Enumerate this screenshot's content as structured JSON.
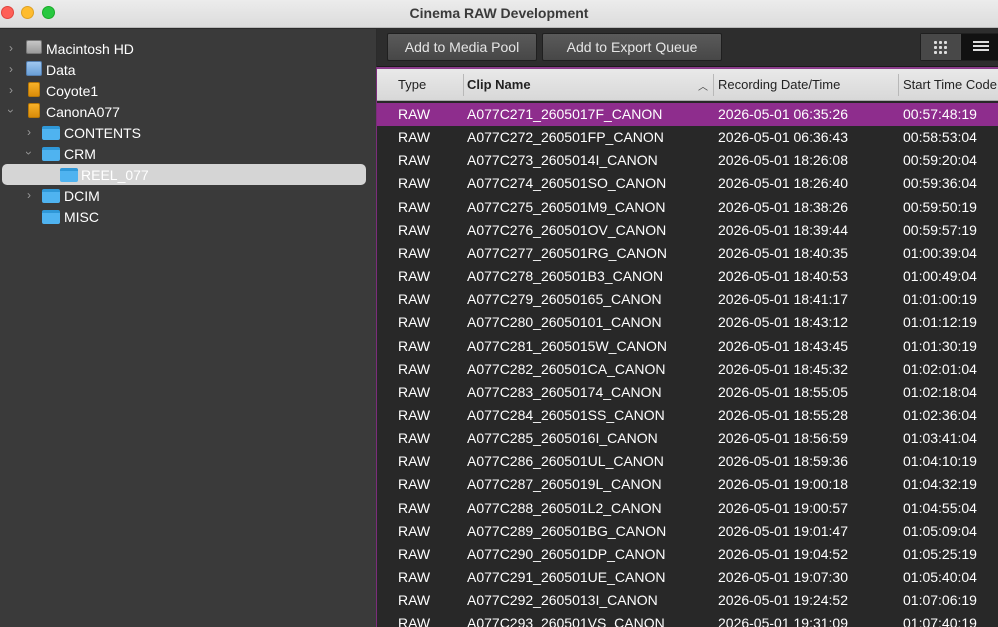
{
  "window": {
    "title": "Cinema RAW Development"
  },
  "sidebar": {
    "items": [
      {
        "label": "Macintosh HD",
        "icon": "internal-drive-icon",
        "expanded": false
      },
      {
        "label": "Data",
        "icon": "drive-icon",
        "expanded": false
      },
      {
        "label": "Coyote1",
        "icon": "external-drive-icon",
        "expanded": false
      },
      {
        "label": "CanonA077",
        "icon": "external-drive-icon",
        "expanded": true
      },
      {
        "label": "CONTENTS",
        "icon": "folder-icon",
        "expanded": false
      },
      {
        "label": "CRM",
        "icon": "folder-icon",
        "expanded": true
      },
      {
        "label": "REEL_077",
        "icon": "folder-icon",
        "selected": true
      },
      {
        "label": "DCIM",
        "icon": "folder-icon",
        "expanded": false
      },
      {
        "label": "MISC",
        "icon": "folder-icon"
      }
    ]
  },
  "toolbar": {
    "add_media_pool": "Add to Media Pool",
    "add_export_queue": "Add to Export Queue",
    "active_view": "list"
  },
  "table": {
    "columns": {
      "type": "Type",
      "clip_name": "Clip Name",
      "date": "Recording Date/Time",
      "timecode": "Start Time Code"
    },
    "rows": [
      {
        "type": "RAW",
        "name": "A077C271_2605017F_CANON",
        "date": "2026-05-01 06:35:26",
        "tc": "00:57:48:19"
      },
      {
        "type": "RAW",
        "name": "A077C272_260501FP_CANON",
        "date": "2026-05-01 06:36:43",
        "tc": "00:58:53:04"
      },
      {
        "type": "RAW",
        "name": "A077C273_2605014I_CANON",
        "date": "2026-05-01 18:26:08",
        "tc": "00:59:20:04"
      },
      {
        "type": "RAW",
        "name": "A077C274_260501SO_CANON",
        "date": "2026-05-01 18:26:40",
        "tc": "00:59:36:04"
      },
      {
        "type": "RAW",
        "name": "A077C275_260501M9_CANON",
        "date": "2026-05-01 18:38:26",
        "tc": "00:59:50:19"
      },
      {
        "type": "RAW",
        "name": "A077C276_260501OV_CANON",
        "date": "2026-05-01 18:39:44",
        "tc": "00:59:57:19"
      },
      {
        "type": "RAW",
        "name": "A077C277_260501RG_CANON",
        "date": "2026-05-01 18:40:35",
        "tc": "01:00:39:04"
      },
      {
        "type": "RAW",
        "name": "A077C278_260501B3_CANON",
        "date": "2026-05-01 18:40:53",
        "tc": "01:00:49:04"
      },
      {
        "type": "RAW",
        "name": "A077C279_26050165_CANON",
        "date": "2026-05-01 18:41:17",
        "tc": "01:01:00:19"
      },
      {
        "type": "RAW",
        "name": "A077C280_26050101_CANON",
        "date": "2026-05-01 18:43:12",
        "tc": "01:01:12:19"
      },
      {
        "type": "RAW",
        "name": "A077C281_2605015W_CANON",
        "date": "2026-05-01 18:43:45",
        "tc": "01:01:30:19"
      },
      {
        "type": "RAW",
        "name": "A077C282_260501CA_CANON",
        "date": "2026-05-01 18:45:32",
        "tc": "01:02:01:04"
      },
      {
        "type": "RAW",
        "name": "A077C283_26050174_CANON",
        "date": "2026-05-01 18:55:05",
        "tc": "01:02:18:04"
      },
      {
        "type": "RAW",
        "name": "A077C284_260501SS_CANON",
        "date": "2026-05-01 18:55:28",
        "tc": "01:02:36:04"
      },
      {
        "type": "RAW",
        "name": "A077C285_2605016I_CANON",
        "date": "2026-05-01 18:56:59",
        "tc": "01:03:41:04"
      },
      {
        "type": "RAW",
        "name": "A077C286_260501UL_CANON",
        "date": "2026-05-01 18:59:36",
        "tc": "01:04:10:19"
      },
      {
        "type": "RAW",
        "name": "A077C287_2605019L_CANON",
        "date": "2026-05-01 19:00:18",
        "tc": "01:04:32:19"
      },
      {
        "type": "RAW",
        "name": "A077C288_260501L2_CANON",
        "date": "2026-05-01 19:00:57",
        "tc": "01:04:55:04"
      },
      {
        "type": "RAW",
        "name": "A077C289_260501BG_CANON",
        "date": "2026-05-01 19:01:47",
        "tc": "01:05:09:04"
      },
      {
        "type": "RAW",
        "name": "A077C290_260501DP_CANON",
        "date": "2026-05-01 19:04:52",
        "tc": "01:05:25:19"
      },
      {
        "type": "RAW",
        "name": "A077C291_260501UE_CANON",
        "date": "2026-05-01 19:07:30",
        "tc": "01:05:40:04"
      },
      {
        "type": "RAW",
        "name": "A077C292_2605013I_CANON",
        "date": "2026-05-01 19:24:52",
        "tc": "01:07:06:19"
      },
      {
        "type": "RAW",
        "name": "A077C293_260501VS_CANON",
        "date": "2026-05-01 19:31:09",
        "tc": "01:07:40:19"
      }
    ],
    "selected_row": 0
  },
  "colors": {
    "selection": "#8e2d8d",
    "row_text": "#ffffff",
    "sidebar_bg": "#3a3a3a",
    "table_bg": "#282828"
  }
}
